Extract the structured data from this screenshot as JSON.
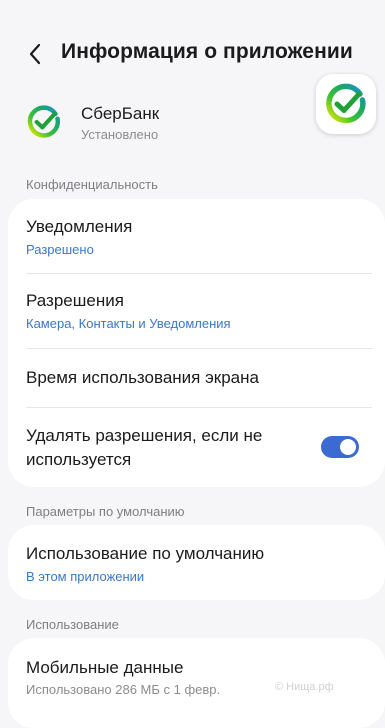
{
  "header": {
    "title": "Информация о приложении"
  },
  "app": {
    "name": "СберБанк",
    "status": "Установлено"
  },
  "sections": {
    "privacy": "Конфиденциальность",
    "defaults": "Параметры по умолчанию",
    "usage": "Использование"
  },
  "privacy_items": {
    "notifications": {
      "title": "Уведомления",
      "subtitle": "Разрешено"
    },
    "permissions": {
      "title": "Разрешения",
      "subtitle": "Камера, Контакты и Уведомления"
    },
    "screen_time": {
      "title": "Время использования экрана"
    },
    "remove_permissions": {
      "title_line1": "Удалять разрешения, если не",
      "title_line2": "используется",
      "toggle_on": true
    }
  },
  "default_items": {
    "open_by_default": {
      "title": "Использование по умолчанию",
      "subtitle": "В этом приложении"
    }
  },
  "usage_items": {
    "mobile_data": {
      "title": "Мобильные данные",
      "subtitle": "Использовано 286 МБ с 1 февр."
    }
  },
  "watermark": "© Нища.рф",
  "colors": {
    "accent": "#3b6ad2",
    "link": "#3b77c8",
    "background": "#f6f6f9",
    "sber_green": "#21a038"
  },
  "icons": {
    "back": "chevron-left-icon",
    "app": "sberbank-logo-icon"
  }
}
